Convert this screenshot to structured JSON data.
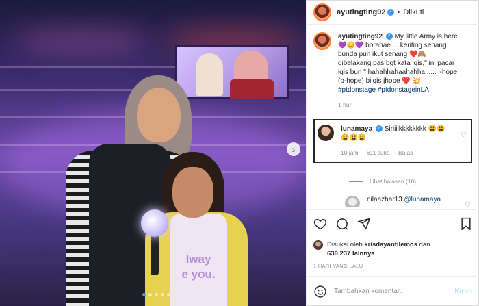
{
  "post": {
    "author": "ayutingting92",
    "follow_status": "Diikuti",
    "separator": "•",
    "caption_lines": [
      "My little Army is here",
      "💜😊💜 borahae.....keriting senang",
      "bunda pun ikut senang ❤️🙈",
      "dibelakang pas bgt kata iqis,\" ini pacar",
      "iqis bun \" hahahhahaahahha...... j-hope",
      "(b-hope) bilqis jhope ❤️ 💥"
    ],
    "hashtags": "#ptdonstage #ptdonstageinLA",
    "caption_time": "1 hari"
  },
  "highlighted_comment": {
    "author": "lunamaya",
    "text": "Siriiiikkkkkkkk 😩😩",
    "text2": "😩😩😩",
    "time": "10 jam",
    "likes": "611 suka",
    "reply": "Balas"
  },
  "view_replies": "Lihat balasan (10)",
  "sub_comment": {
    "author": "nilaazhar13",
    "mention": "@lunamaya"
  },
  "likes": {
    "prefix": "Disukai oleh",
    "user": "krisdayantilemos",
    "conj": "dan",
    "count": "639,237",
    "suffix": "lainnya"
  },
  "posted_time": "1 HARI YANG LALU",
  "add_comment": {
    "placeholder": "Tambahkan komentar...",
    "post_label": "Kirim"
  },
  "photo_screen_text": "",
  "shirt_text": "lway\ne you.",
  "colors": {
    "link": "#00376b",
    "muted": "#8e8e8e",
    "post_disabled": "#b2dffc",
    "verified": "#3897f0",
    "heart_red": "#ed4956"
  }
}
